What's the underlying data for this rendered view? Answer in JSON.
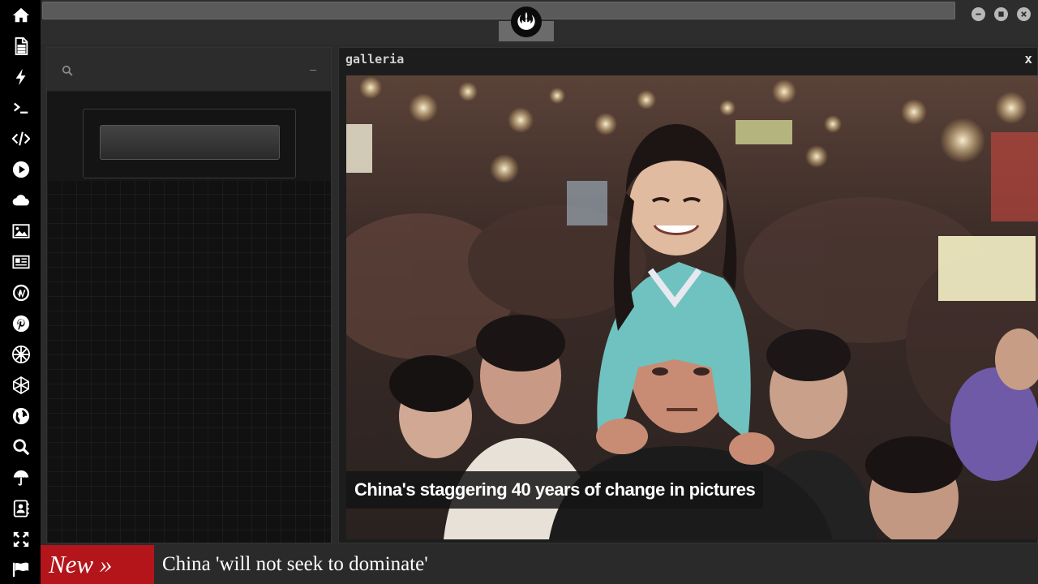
{
  "sidebar": {
    "items": [
      {
        "icon": "home-icon"
      },
      {
        "icon": "document-icon"
      },
      {
        "icon": "lightning-icon"
      },
      {
        "icon": "terminal-icon"
      },
      {
        "icon": "code-icon"
      },
      {
        "icon": "play-icon"
      },
      {
        "icon": "cloud-icon"
      },
      {
        "icon": "image-icon"
      },
      {
        "icon": "newspaper-icon"
      },
      {
        "icon": "wordpress-icon"
      },
      {
        "icon": "pinterest-icon"
      },
      {
        "icon": "empire-icon"
      },
      {
        "icon": "network-icon"
      },
      {
        "icon": "globe-icon"
      },
      {
        "icon": "search-icon"
      },
      {
        "icon": "umbrella-icon"
      },
      {
        "icon": "contact-icon"
      },
      {
        "icon": "expand-icon"
      },
      {
        "icon": "flag-icon"
      }
    ]
  },
  "topbar": {
    "logo_icon": "rebel-alliance-icon",
    "window_controls": [
      "minimize-icon",
      "maximize-icon",
      "close-icon"
    ]
  },
  "search_panel": {
    "minimize_label": "–",
    "search_icon": "search-icon",
    "input_value": ""
  },
  "gallery": {
    "title": "galleria",
    "close_label": "x",
    "caption": "China's staggering 40 years of change in pictures"
  },
  "ticker": {
    "tag": "New »",
    "headline": "China 'will not seek to dominate'"
  },
  "colors": {
    "ticker_red": "#b3151b",
    "sidebar_bg": "#000000",
    "panel_bg": "#2c2c2c"
  }
}
